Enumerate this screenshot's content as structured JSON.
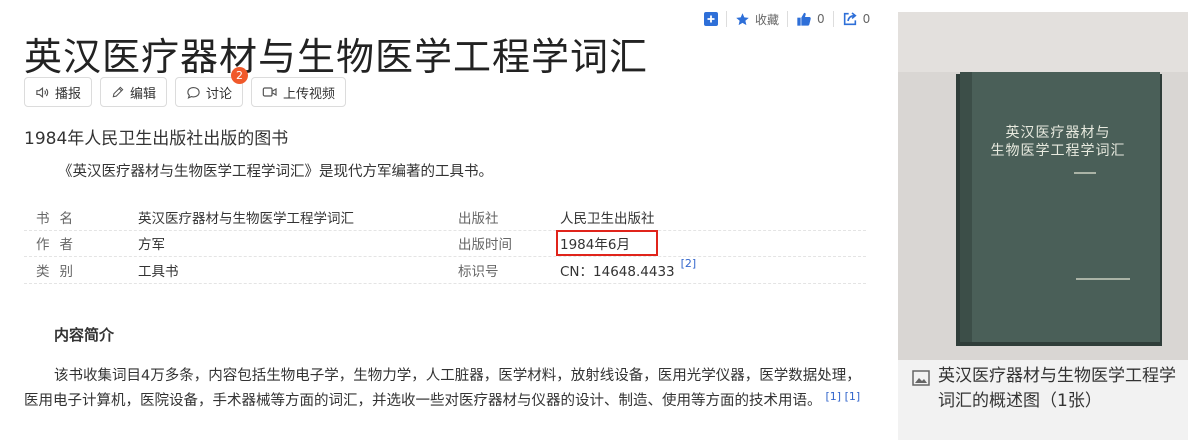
{
  "toolbar": {
    "favorite_label": "收藏",
    "like_count": "0",
    "share_count": "0"
  },
  "page": {
    "title": "英汉医疗器材与生物医学工程学词汇",
    "subtitle": "1984年人民卫生出版社出版的图书",
    "summary": "《英汉医疗器材与生物医学工程学词汇》是现代方军编著的工具书。"
  },
  "actions": {
    "broadcast": "播报",
    "edit": "编辑",
    "discuss": "讨论",
    "discuss_badge": "2",
    "upload_video": "上传视频"
  },
  "infobox": {
    "rows": [
      {
        "k1": "书名",
        "v1": "英汉医疗器材与生物医学工程学词汇",
        "k2": "出版社",
        "v2": "人民卫生出版社"
      },
      {
        "k1": "作者",
        "v1": "方军",
        "k2": "出版时间",
        "v2": "1984年6月"
      },
      {
        "k1": "类别",
        "v1": "工具书",
        "k2": "标识号",
        "v2": "CN：14648.4433",
        "ref": "[2]"
      }
    ]
  },
  "content": {
    "section_title": "内容简介",
    "paragraph": "该书收集词目4万多条，内容包括生物电子学，生物力学，人工脏器，医学材料，放射线设备，医用光学仪器，医学数据处理，医用电子计算机，医院设备，手术器械等方面的词汇，并选收一些对医疗器材与仪器的设计、制造、使用等方面的技术用语。",
    "refs": "[1]  [1]"
  },
  "side": {
    "book_cover_line1": "英汉医疗器材与",
    "book_cover_line2": "生物医学工程学词汇",
    "caption": "英汉医疗器材与生物医学工程学词汇的概述图（1张）"
  },
  "colors": {
    "accent_blue": "#3366cc",
    "toolbar_icon": "#2e6fd8",
    "badge_orange": "#f0592b",
    "highlight_red": "#e0241b",
    "book_cover": "#4a5f58"
  }
}
